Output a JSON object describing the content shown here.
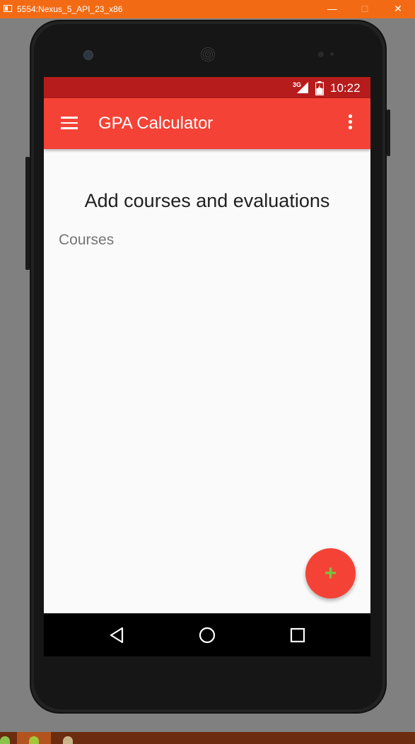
{
  "window": {
    "title": "5554:Nexus_5_API_23_x86",
    "minimize_label": "—",
    "maximize_label": "□",
    "close_label": "✕"
  },
  "status_bar": {
    "network_type": "3G",
    "time": "10:22"
  },
  "app_bar": {
    "title": "GPA Calculator",
    "menu_icon": "hamburger-menu-icon",
    "overflow_icon": "more-vert-icon"
  },
  "content": {
    "headline": "Add courses and evaluations",
    "section_label": "Courses"
  },
  "fab": {
    "label": "+",
    "icon": "add-icon"
  },
  "nav_bar": {
    "back_icon": "back-triangle-icon",
    "home_icon": "home-circle-icon",
    "recents_icon": "recents-square-icon"
  },
  "colors": {
    "status_bar": "#b71c1c",
    "app_bar": "#f44336",
    "fab": "#f44336",
    "fab_icon": "#76c442",
    "background": "#fafafa",
    "title_bar": "#f26b14"
  }
}
